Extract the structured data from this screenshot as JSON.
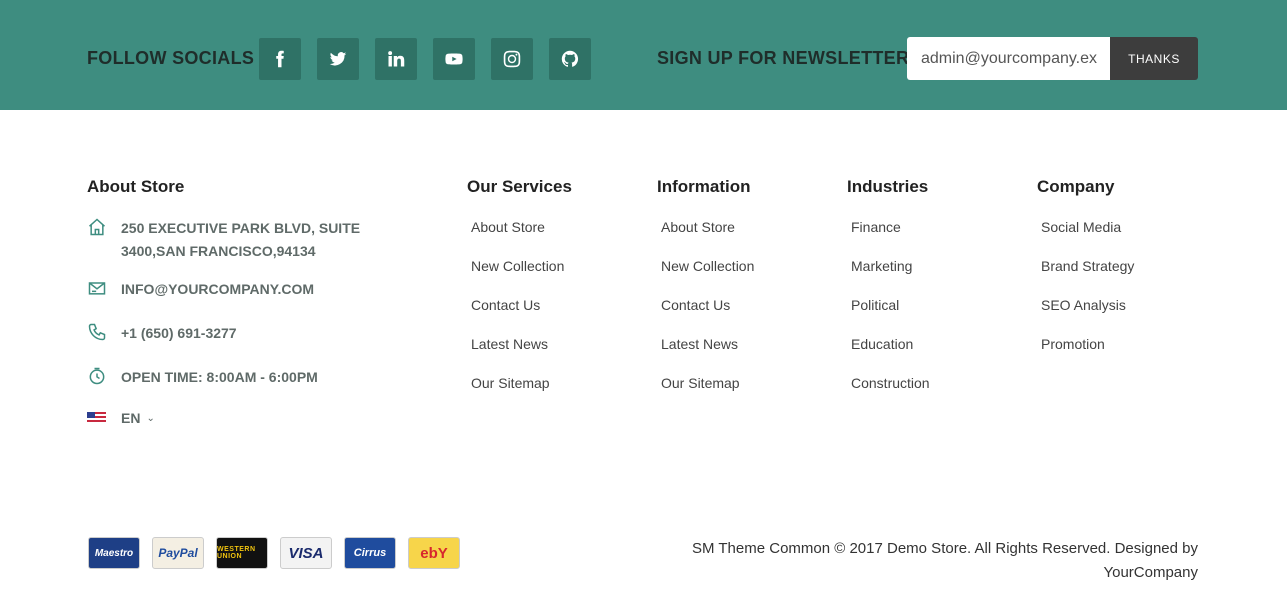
{
  "header": {
    "follow_title": "FOLLOW SOCIALS",
    "socials": [
      {
        "name": "facebook-icon"
      },
      {
        "name": "twitter-icon"
      },
      {
        "name": "linkedin-icon"
      },
      {
        "name": "youtube-icon"
      },
      {
        "name": "instagram-icon"
      },
      {
        "name": "github-icon"
      }
    ],
    "newsletter_title": "SIGN UP FOR NEWSLETTER",
    "newsletter_value": "admin@yourcompany.ex",
    "newsletter_button": "THANKS",
    "bar_color": "#3e8d80"
  },
  "about": {
    "title": "About Store",
    "address": "250 EXECUTIVE PARK BLVD, SUITE 3400,SAN FRANCISCO,94134",
    "email": "INFO@YOURCOMPANY.COM",
    "phone": "+1 (650) 691-3277",
    "hours": "OPEN TIME: 8:00AM - 6:00PM",
    "language": "EN"
  },
  "columns": [
    {
      "title": "Our Services",
      "items": [
        "About Store",
        "New Collection",
        "Contact Us",
        "Latest News",
        "Our Sitemap"
      ]
    },
    {
      "title": "Information",
      "items": [
        "About Store",
        "New Collection",
        "Contact Us",
        "Latest News",
        "Our Sitemap"
      ]
    },
    {
      "title": "Industries",
      "items": [
        "Finance",
        "Marketing",
        "Political",
        "Education",
        "Construction"
      ]
    },
    {
      "title": "Company",
      "items": [
        "Social Media",
        "Brand Strategy",
        "SEO Analysis",
        "Promotion"
      ]
    }
  ],
  "payments": [
    "Maestro",
    "PayPal",
    "WESTERN UNION",
    "VISA",
    "Cirrus",
    "ebY"
  ],
  "copyright": "SM Theme Common © 2017 Demo Store. All Rights Reserved. Designed by YourCompany",
  "accent_color": "#3e8d80"
}
